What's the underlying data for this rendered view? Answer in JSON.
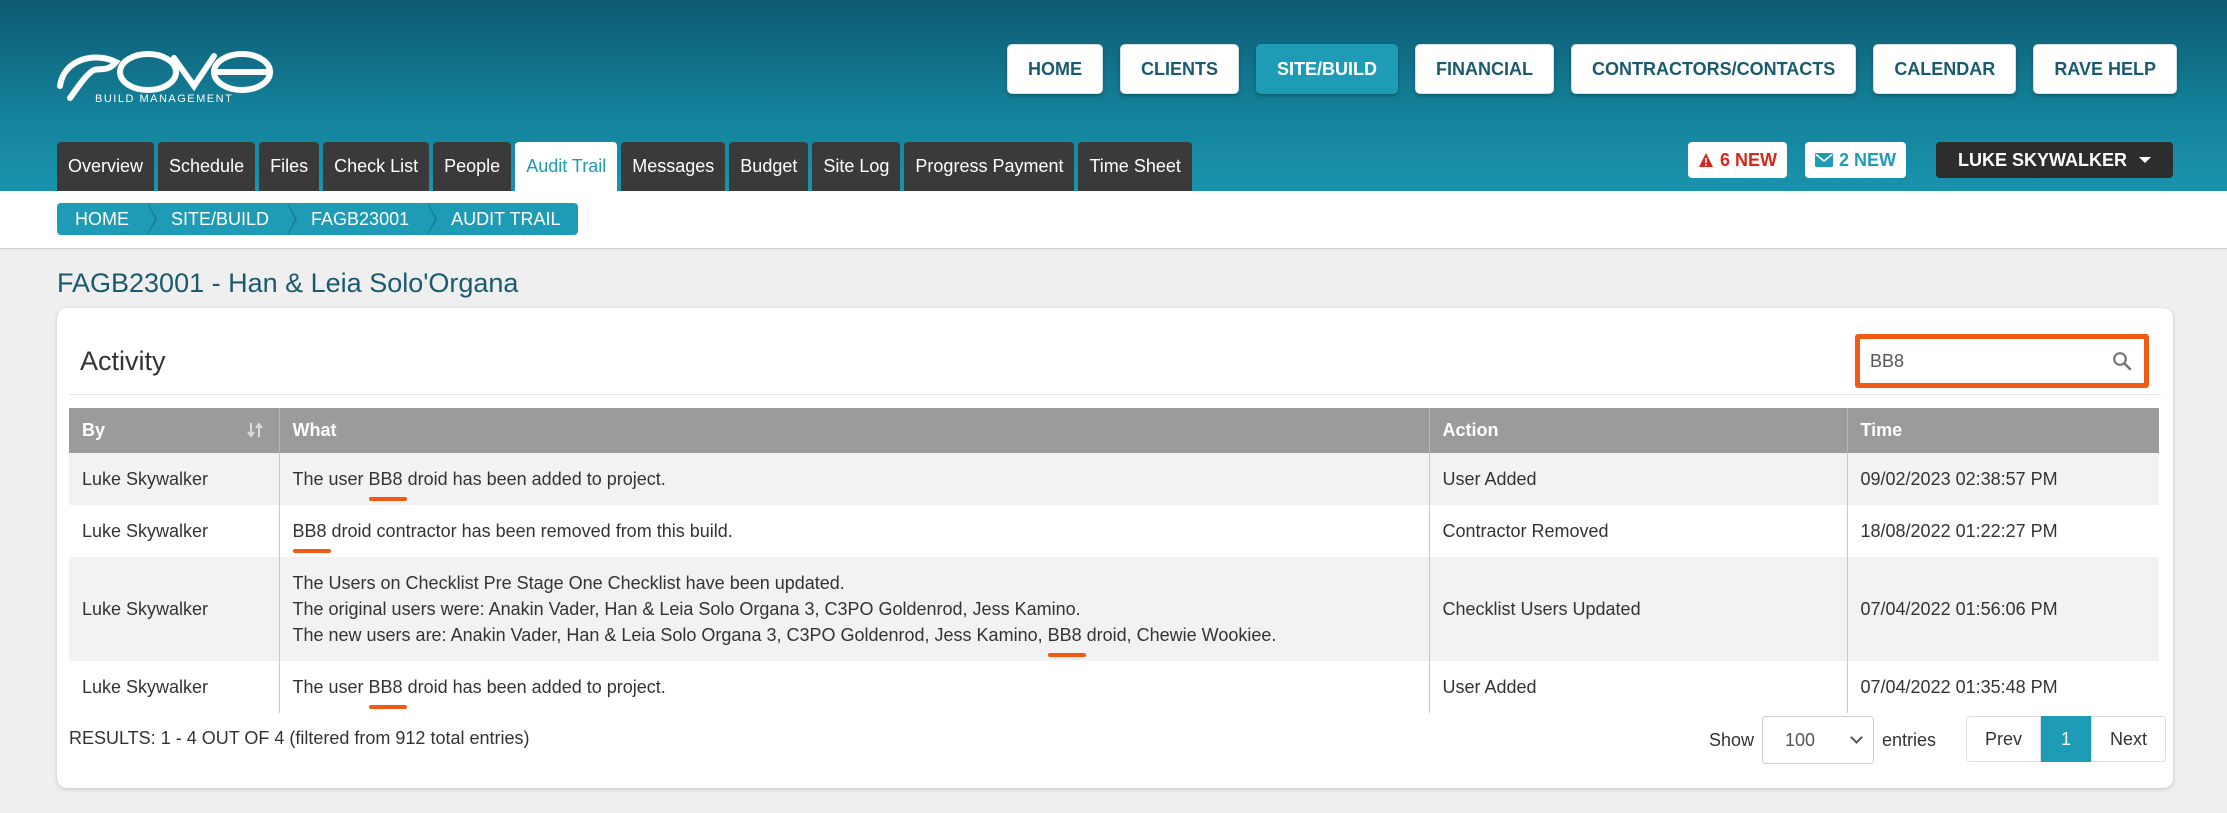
{
  "brand": {
    "logo_text": "rave",
    "subtitle": "BUILD MANAGEMENT"
  },
  "topnav": [
    {
      "label": "HOME",
      "active": false
    },
    {
      "label": "CLIENTS",
      "active": false
    },
    {
      "label": "SITE/BUILD",
      "active": true
    },
    {
      "label": "FINANCIAL",
      "active": false
    },
    {
      "label": "CONTRACTORS/CONTACTS",
      "active": false
    },
    {
      "label": "CALENDAR",
      "active": false
    },
    {
      "label": "RAVE HELP",
      "active": false
    }
  ],
  "tabs": [
    {
      "label": "Overview",
      "active": false
    },
    {
      "label": "Schedule",
      "active": false
    },
    {
      "label": "Files",
      "active": false
    },
    {
      "label": "Check List",
      "active": false
    },
    {
      "label": "People",
      "active": false
    },
    {
      "label": "Audit Trail",
      "active": true
    },
    {
      "label": "Messages",
      "active": false
    },
    {
      "label": "Budget",
      "active": false
    },
    {
      "label": "Site Log",
      "active": false
    },
    {
      "label": "Progress Payment",
      "active": false
    },
    {
      "label": "Time Sheet",
      "active": false
    }
  ],
  "notifications": {
    "alerts": "6 NEW",
    "messages": "2 NEW"
  },
  "user": {
    "name": "LUKE SKYWALKER"
  },
  "breadcrumb": [
    "HOME",
    "SITE/BUILD",
    "FAGB23001",
    "AUDIT TRAIL"
  ],
  "page_title": "FAGB23001 - Han & Leia Solo'Organa",
  "activity": {
    "title": "Activity",
    "search_value": "BB8",
    "columns": {
      "by": "By",
      "what": "What",
      "action": "Action",
      "time": "Time"
    },
    "rows": [
      {
        "by": "Luke Skywalker",
        "what": [
          {
            "pre": "The user ",
            "hl": "BB8",
            "post": " droid has been added to project."
          }
        ],
        "action": "User Added",
        "time": "09/02/2023 02:38:57 PM"
      },
      {
        "by": "Luke Skywalker",
        "what": [
          {
            "pre": "",
            "hl": "BB8",
            "post": " droid contractor has been removed from this build."
          }
        ],
        "action": "Contractor Removed",
        "time": "18/08/2022 01:22:27 PM"
      },
      {
        "by": "Luke Skywalker",
        "what": [
          {
            "pre": "The Users on Checklist Pre Stage One Checklist have been updated.",
            "hl": "",
            "post": ""
          },
          {
            "pre": "The original users were: Anakin Vader, Han & Leia Solo Organa 3, C3PO Goldenrod, Jess Kamino.",
            "hl": "",
            "post": ""
          },
          {
            "pre": "The new users are: Anakin Vader, Han & Leia Solo Organa 3, C3PO Goldenrod, Jess Kamino, ",
            "hl": "BB8",
            "post": " droid, Chewie Wookiee."
          }
        ],
        "action": "Checklist Users Updated",
        "time": "07/04/2022 01:56:06 PM"
      },
      {
        "by": "Luke Skywalker",
        "what": [
          {
            "pre": "The user ",
            "hl": "BB8",
            "post": " droid has been added to project."
          }
        ],
        "action": "User Added",
        "time": "07/04/2022 01:35:48 PM"
      }
    ],
    "results_text": "RESULTS: 1 - 4 OUT OF 4 (filtered from 912 total entries)",
    "show_label": "Show",
    "page_size": "100",
    "entries_label": "entries",
    "pager": {
      "prev": "Prev",
      "current": "1",
      "next": "Next"
    }
  },
  "colors": {
    "accent": "#1f9cb5",
    "highlight": "#f05a13",
    "header_dark": "#0d5a72"
  }
}
